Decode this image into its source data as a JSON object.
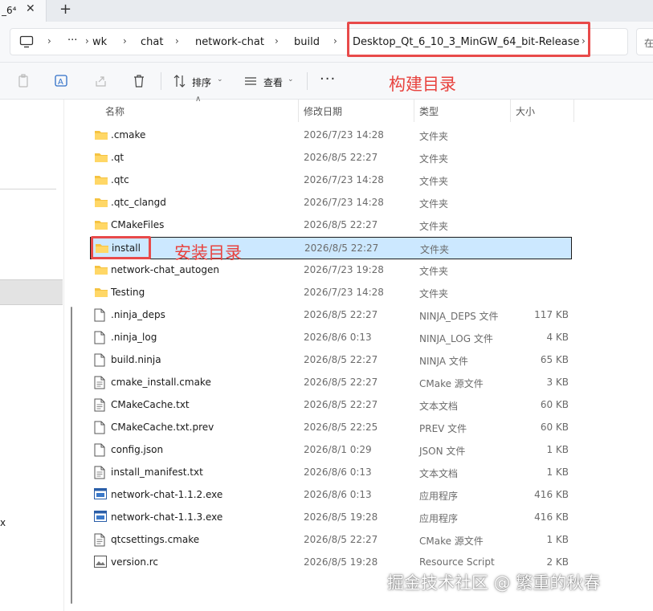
{
  "tab": {
    "title": "_6⁴",
    "close": "✕",
    "add": "+"
  },
  "address": {
    "more": "···",
    "crumbs": [
      "wk",
      "chat",
      "network-chat",
      "build",
      "Desktop_Qt_6_10_3_MinGW_64_bit-Release"
    ],
    "chevron": "›",
    "search_text": "在"
  },
  "toolbar": {
    "sort_label": "排序",
    "view_label": "查看",
    "more": "···"
  },
  "annotations": {
    "build_dir": "构建目录",
    "install_dir": "安装目录",
    "watermark": "掘金技术社区 @ 繁重的秋春"
  },
  "nav": {
    "partial_text": "x"
  },
  "columns": {
    "name": "名称",
    "date": "修改日期",
    "type": "类型",
    "size": "大小"
  },
  "colors": {
    "accent_red": "#e84a4a",
    "selection": "#cce8ff",
    "folder": "#f5c342"
  },
  "files": [
    {
      "name": ".cmake",
      "date": "2026/7/23 14:28",
      "type": "文件夹",
      "size": "",
      "icon": "folder-icon"
    },
    {
      "name": ".qt",
      "date": "2026/8/5 22:27",
      "type": "文件夹",
      "size": "",
      "icon": "folder-icon"
    },
    {
      "name": ".qtc",
      "date": "2026/7/23 14:28",
      "type": "文件夹",
      "size": "",
      "icon": "folder-icon"
    },
    {
      "name": ".qtc_clangd",
      "date": "2026/7/23 14:28",
      "type": "文件夹",
      "size": "",
      "icon": "folder-icon"
    },
    {
      "name": "CMakeFiles",
      "date": "2026/8/5 22:27",
      "type": "文件夹",
      "size": "",
      "icon": "folder-icon"
    },
    {
      "name": "install",
      "date": "2026/8/5 22:27",
      "type": "文件夹",
      "size": "",
      "icon": "folder-icon"
    },
    {
      "name": "network-chat_autogen",
      "date": "2026/7/23 19:28",
      "type": "文件夹",
      "size": "",
      "icon": "folder-icon"
    },
    {
      "name": "Testing",
      "date": "2026/7/23 14:28",
      "type": "文件夹",
      "size": "",
      "icon": "folder-icon"
    },
    {
      "name": ".ninja_deps",
      "date": "2026/8/5 22:27",
      "type": "NINJA_DEPS 文件",
      "size": "117 KB",
      "icon": "file-icon"
    },
    {
      "name": ".ninja_log",
      "date": "2026/8/6 0:13",
      "type": "NINJA_LOG 文件",
      "size": "4 KB",
      "icon": "file-icon"
    },
    {
      "name": "build.ninja",
      "date": "2026/8/5 22:27",
      "type": "NINJA 文件",
      "size": "65 KB",
      "icon": "file-icon"
    },
    {
      "name": "cmake_install.cmake",
      "date": "2026/8/5 22:27",
      "type": "CMake 源文件",
      "size": "3 KB",
      "icon": "text-file-icon"
    },
    {
      "name": "CMakeCache.txt",
      "date": "2026/8/5 22:27",
      "type": "文本文档",
      "size": "60 KB",
      "icon": "text-file-icon"
    },
    {
      "name": "CMakeCache.txt.prev",
      "date": "2026/8/5 22:25",
      "type": "PREV 文件",
      "size": "60 KB",
      "icon": "file-icon"
    },
    {
      "name": "config.json",
      "date": "2026/8/1 0:29",
      "type": "JSON 文件",
      "size": "1 KB",
      "icon": "file-icon"
    },
    {
      "name": "install_manifest.txt",
      "date": "2026/8/6 0:13",
      "type": "文本文档",
      "size": "1 KB",
      "icon": "text-file-icon"
    },
    {
      "name": "network-chat-1.1.2.exe",
      "date": "2026/8/6 0:13",
      "type": "应用程序",
      "size": "416 KB",
      "icon": "exe-icon"
    },
    {
      "name": "network-chat-1.1.3.exe",
      "date": "2026/8/5 19:28",
      "type": "应用程序",
      "size": "416 KB",
      "icon": "exe-icon"
    },
    {
      "name": "qtcsettings.cmake",
      "date": "2026/8/5 22:27",
      "type": "CMake 源文件",
      "size": "1 KB",
      "icon": "text-file-icon"
    },
    {
      "name": "version.rc",
      "date": "2026/8/5 19:28",
      "type": "Resource Script",
      "size": "2 KB",
      "icon": "image-file-icon"
    }
  ]
}
